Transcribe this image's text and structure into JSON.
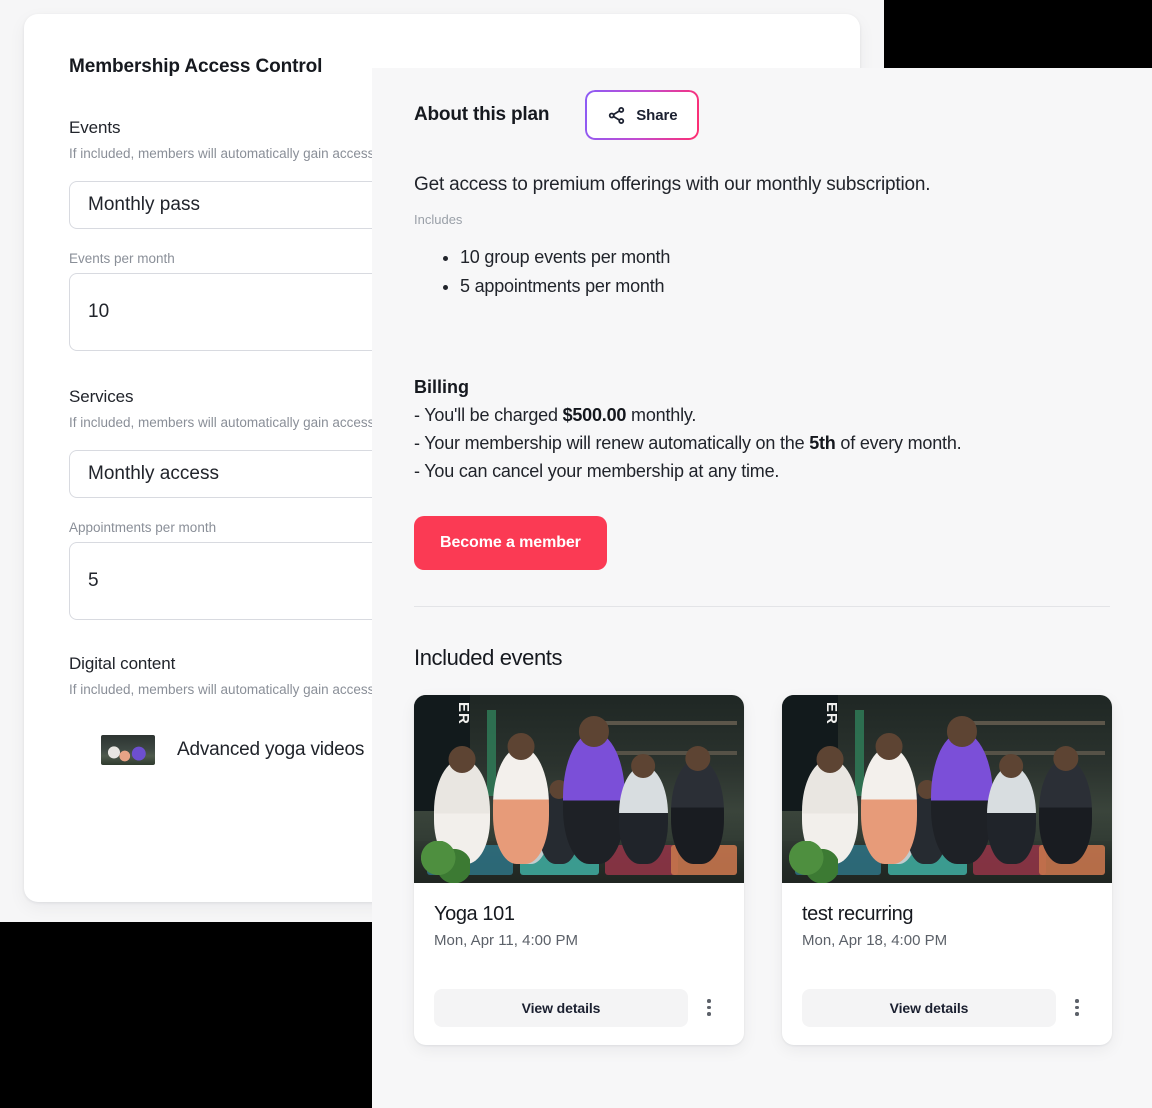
{
  "left_panel": {
    "title": "Membership Access Control",
    "sections": [
      {
        "heading": "Events",
        "description": "If included, members will automatically gain access to all events at no additional price",
        "select_value": "Monthly pass",
        "field_label": "Events per month",
        "field_value": "10"
      },
      {
        "heading": "Services",
        "description": "If included, members will automatically gain access to all services without paying the price",
        "select_value": "Monthly access",
        "field_label": "Appointments per month",
        "field_value": "5"
      },
      {
        "heading": "Digital content",
        "description": "If included, members will automatically gain access to digital content without having to pay the price",
        "content_item": "Advanced yoga videos"
      }
    ]
  },
  "right_panel": {
    "heading": "About this plan",
    "share_label": "Share",
    "summary": "Get access to premium offerings with our monthly subscription.",
    "includes_label": "Includes",
    "includes": [
      "10 group events per month",
      "5 appointments per month"
    ],
    "billing": {
      "title": "Billing",
      "line1_prefix": "- You'll be charged ",
      "line1_amount": "$500.00",
      "line1_suffix": " monthly.",
      "line2_prefix": "- Your membership will renew automatically on the ",
      "line2_day": "5th",
      "line2_suffix": " of every month.",
      "line3": "- You can cancel your membership at any time."
    },
    "cta_label": "Become a member",
    "events_heading": "Included events",
    "events": [
      {
        "name": "Yoga 101",
        "date": "Mon, Apr 11, 4:00 PM",
        "action_label": "View details",
        "photo_letters": "ER"
      },
      {
        "name": "test recurring",
        "date": "Mon, Apr 18, 4:00 PM",
        "action_label": "View details",
        "photo_letters": "ER"
      }
    ]
  },
  "colors": {
    "cta_red": "#fb3a54",
    "share_gradient_start": "#8b5cf6",
    "share_gradient_end": "#ff2d6f",
    "panel_bg": "#f7f7f8",
    "card_bg": "#ffffff"
  }
}
